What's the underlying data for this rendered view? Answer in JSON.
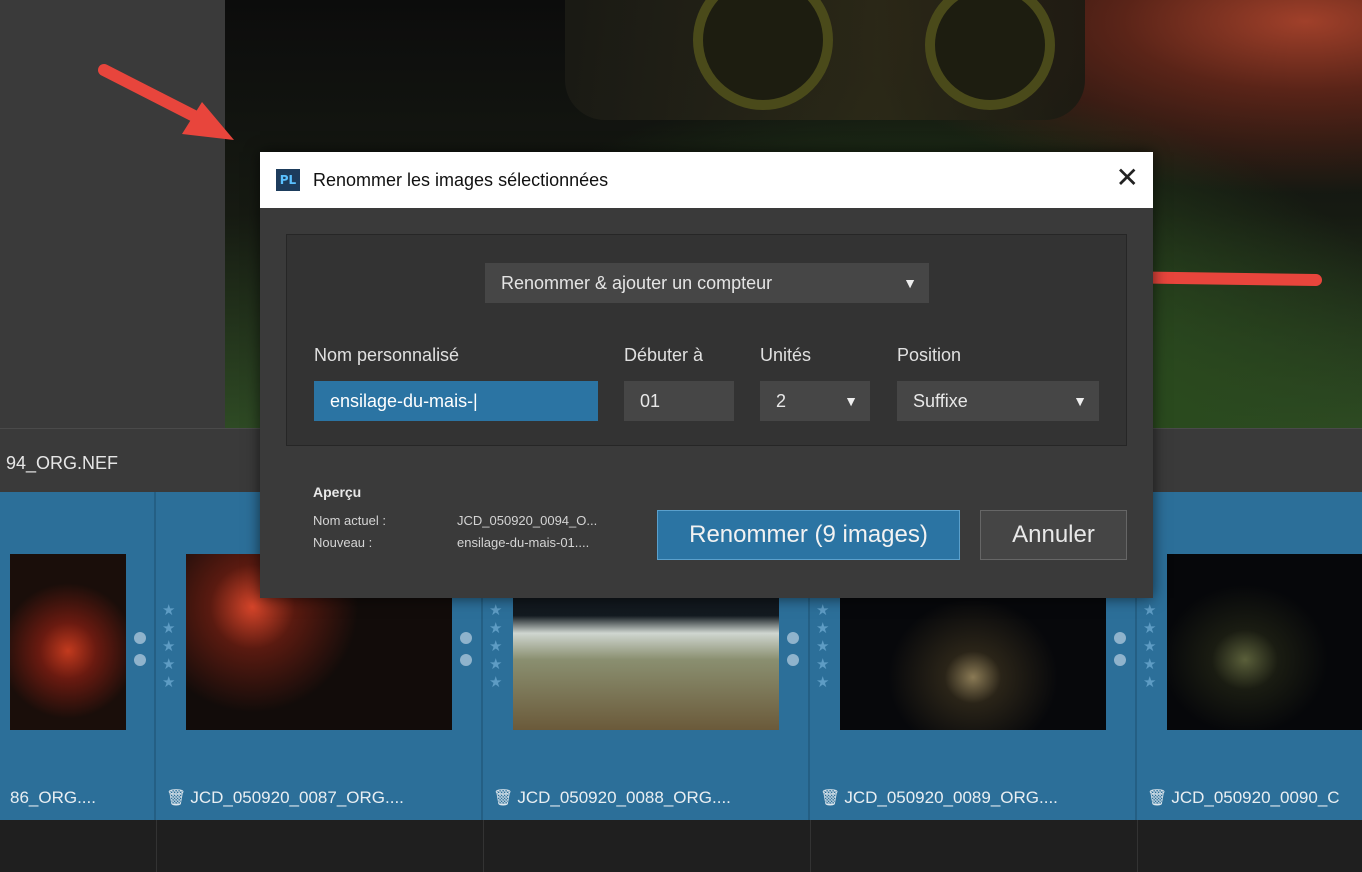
{
  "background": {
    "filename_label": "94_ORG.NEF",
    "thumbnails": [
      {
        "caption": "86_ORG....",
        "has_trash": false
      },
      {
        "caption": "JCD_050920_0087_ORG....",
        "has_trash": true
      },
      {
        "caption": "JCD_050920_0088_ORG....",
        "has_trash": true
      },
      {
        "caption": "JCD_050920_0089_ORG....",
        "has_trash": true
      },
      {
        "caption": "JCD_050920_0090_C",
        "has_trash": true
      }
    ],
    "star_glyph": "★",
    "trash_glyph": "🗑"
  },
  "dialog": {
    "app_icon": "PL",
    "title": "Renommer les images sélectionnées",
    "close_glyph": "✕",
    "mode": {
      "value": "Renommer & ajouter un compteur",
      "caret": "▼"
    },
    "fields": {
      "custom_name": {
        "label": "Nom personnalisé",
        "value": "ensilage-du-mais-|"
      },
      "start_at": {
        "label": "Débuter à",
        "value": "01"
      },
      "units": {
        "label": "Unités",
        "value": "2",
        "caret": "▼"
      },
      "position": {
        "label": "Position",
        "value": "Suffixe",
        "caret": "▼"
      }
    },
    "preview": {
      "title": "Aperçu",
      "current_label": "Nom actuel :",
      "current_value": "JCD_050920_0094_O...",
      "new_label": "Nouveau :",
      "new_value": "ensilage-du-mais-01...."
    },
    "buttons": {
      "rename": "Renommer (9 images)",
      "cancel": "Annuler"
    }
  },
  "colors": {
    "accent": "#2b74a3",
    "annotation_arrow": "#e8453c"
  }
}
